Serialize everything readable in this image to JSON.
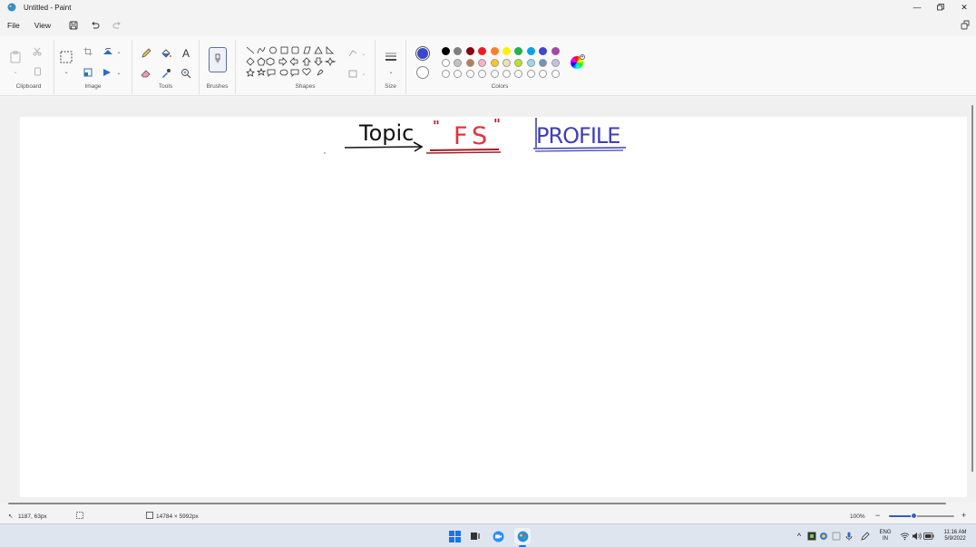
{
  "window": {
    "title": "Untitled - Paint"
  },
  "menu": {
    "file": "File",
    "view": "View"
  },
  "ribbon": {
    "clipboard": "Clipboard",
    "image": "Image",
    "tools": "Tools",
    "brushes": "Brushes",
    "shapes": "Shapes",
    "size": "Size",
    "colors": "Colors"
  },
  "colors": {
    "primary": "#3a49c9",
    "secondary": "#ffffff",
    "palette": [
      "#000000",
      "#7f7f7f",
      "#880015",
      "#ed1c24",
      "#ff7f27",
      "#fff200",
      "#22b14c",
      "#00a2e8",
      "#3f48cc",
      "#a349a4"
    ],
    "palette_row2": [
      "#ffffff",
      "#c3c3c3",
      "#b97a57",
      "#ffaec9",
      "#ffc90e",
      "#efe4b0",
      "#b5e61d",
      "#99d9ea",
      "#7092be",
      "#c8bfe7"
    ]
  },
  "drawing": {
    "topic": "Topic",
    "fs": "FS",
    "open_quote": "\"",
    "close_quote": "\"",
    "profile": "PROFILE"
  },
  "status": {
    "cursor": "1187, 63px",
    "canvas_size": "14784 × 5992px",
    "zoom": "100%"
  },
  "taskbar": {
    "lang_top": "ENG",
    "lang_bottom": "IN",
    "time": "11:16 AM",
    "date": "5/9/2022"
  }
}
